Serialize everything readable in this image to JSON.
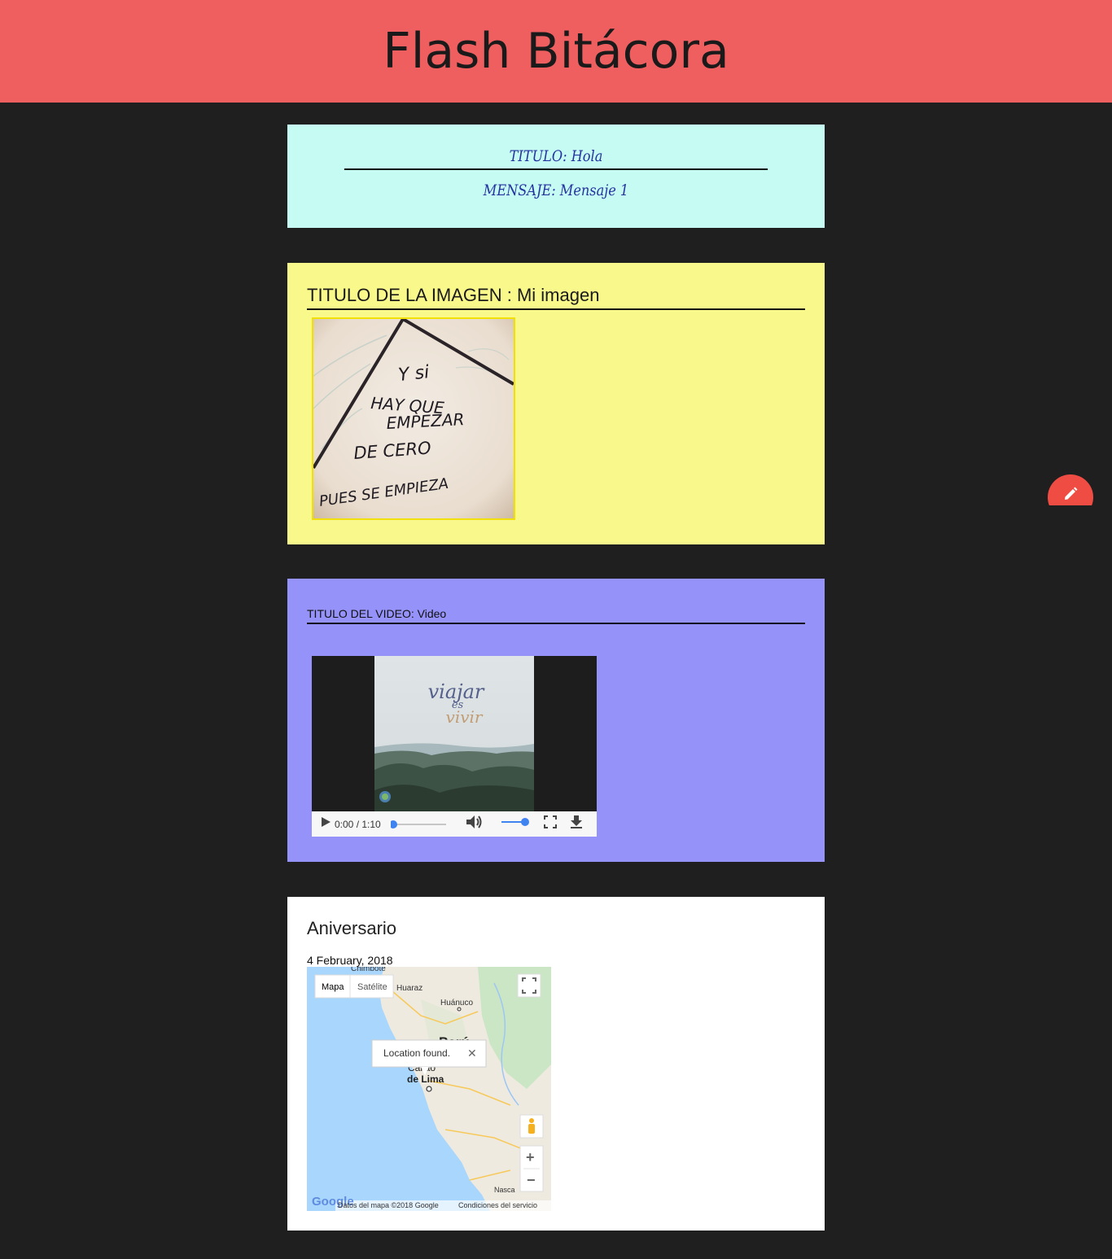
{
  "app": {
    "title": "Flash Bitácora"
  },
  "text_post": {
    "title": "TITULO: Hola",
    "message": "MENSAJE: Mensaje 1"
  },
  "image_post": {
    "title": "TITULO DE LA IMAGEN : Mi imagen",
    "image_text": [
      "Y si",
      "HAY QUE",
      "EMPEZAR",
      "DE CERO",
      "PUES SE EMPIEZA"
    ]
  },
  "video_post": {
    "title": "TITULO DEL VIDEO: Video",
    "frame_text": [
      "viajar",
      "es",
      "vivir"
    ],
    "time": "0:00 / 1:10",
    "progress": 0.0,
    "volume": 1.0
  },
  "event_post": {
    "title": "Aniversario",
    "date": "4 February, 2018",
    "map": {
      "type_buttons": [
        "Mapa",
        "Satélite"
      ],
      "selected_type": "Mapa",
      "cities": [
        "Chimbote",
        "Huaraz",
        "Huánuco",
        "Perú",
        "Callao",
        "de Lima",
        "Nasca"
      ],
      "infowindow": "Location found.",
      "footer": [
        "Datos del mapa ©2018 Google",
        "Condiciones del servicio"
      ],
      "logo": "Google"
    }
  },
  "colors": {
    "header": "#ef5f60",
    "background": "#201f20",
    "text_card": "#c6fbf3",
    "image_card": "#f9f98b",
    "video_card": "#9592fa",
    "fab": "#ef4d44"
  },
  "fab": {
    "icon": "pencil-icon"
  }
}
